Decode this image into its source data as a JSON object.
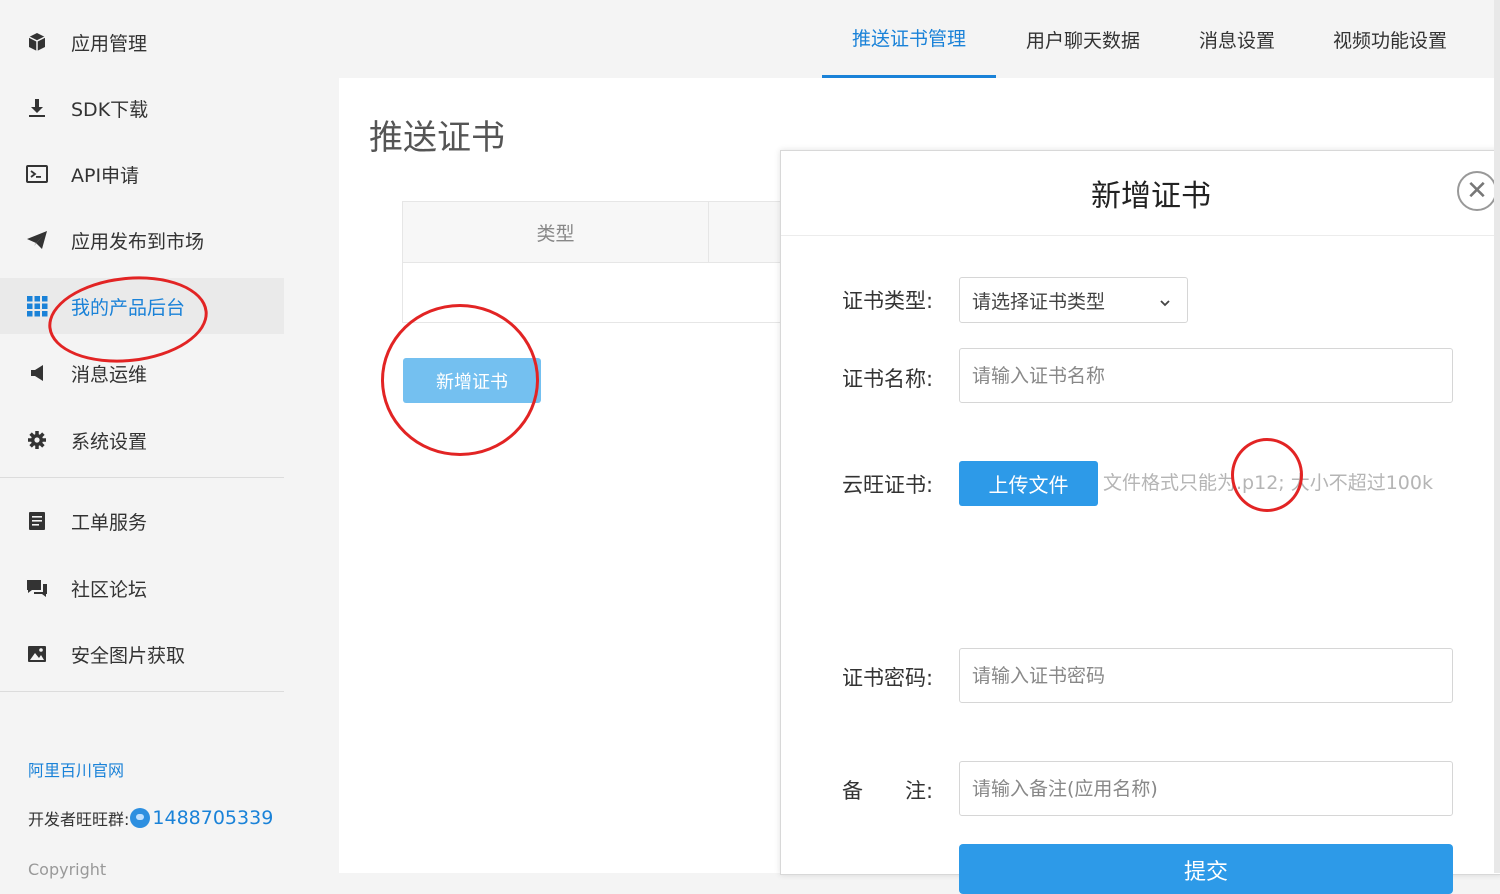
{
  "sidebar": {
    "items": [
      {
        "label": "应用管理",
        "icon": "cube-icon"
      },
      {
        "label": "SDK下载",
        "icon": "download-icon"
      },
      {
        "label": "API申请",
        "icon": "terminal-icon"
      },
      {
        "label": "应用发布到市场",
        "icon": "paper-plane-icon"
      },
      {
        "label": "我的产品后台",
        "icon": "grid-icon",
        "active": true
      },
      {
        "label": "消息运维",
        "icon": "megaphone-icon"
      },
      {
        "label": "系统设置",
        "icon": "gear-icon"
      },
      {
        "label": "工单服务",
        "icon": "document-icon"
      },
      {
        "label": "社区论坛",
        "icon": "chat-icon"
      },
      {
        "label": "安全图片获取",
        "icon": "image-icon"
      }
    ],
    "official_site": "阿里百川官网",
    "dev_group_label": "开发者旺旺群:",
    "dev_group_number": "1488705339",
    "copyright": "Copyright"
  },
  "tabs": [
    {
      "label": "推送证书管理",
      "active": true
    },
    {
      "label": "用户聊天数据"
    },
    {
      "label": "消息设置"
    },
    {
      "label": "视频功能设置"
    }
  ],
  "main": {
    "title": "推送证书",
    "table_header_type": "类型",
    "add_button": "新增证书"
  },
  "modal": {
    "title": "新增证书",
    "close_symbol": "✕",
    "fields": {
      "type_label": "证书类型:",
      "type_select": "请选择证书类型",
      "name_label": "证书名称:",
      "name_placeholder": "请输入证书名称",
      "cloud_label": "云旺证书:",
      "upload_button": "上传文件",
      "upload_hint": "文件格式只能为.p12; 大小不超过100k",
      "password_label": "证书密码:",
      "password_placeholder": "请输入证书密码",
      "remark_label": "备　　注:",
      "remark_placeholder": "请输入备注(应用名称)"
    },
    "submit_button": "提交"
  },
  "colors": {
    "accent": "#1a82d8",
    "primary_button": "#2d9ae8",
    "light_button": "#74c0f0",
    "annotation": "#e22424"
  }
}
